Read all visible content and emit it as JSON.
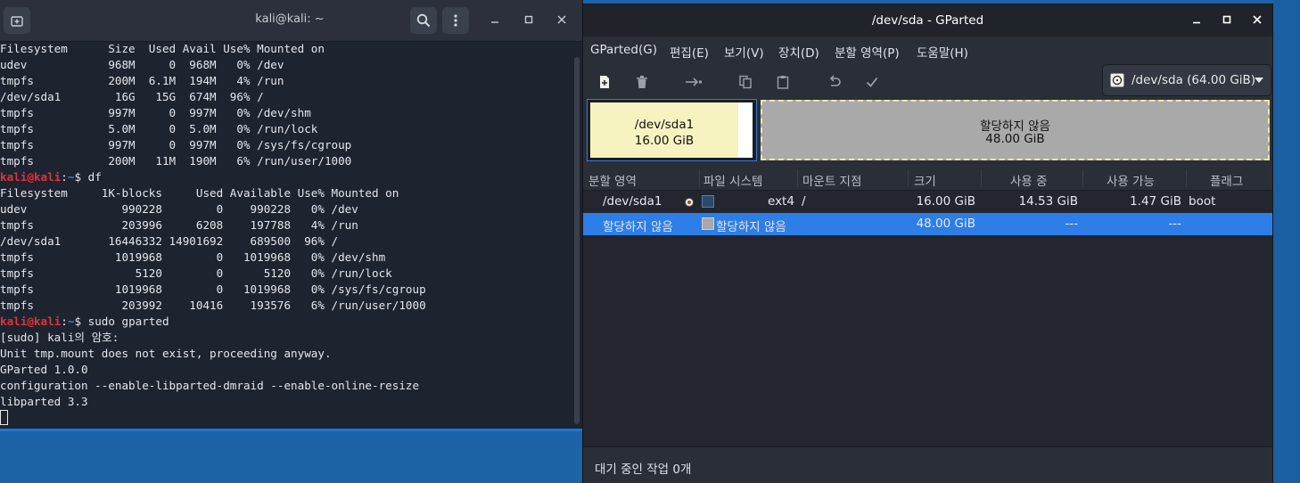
{
  "terminal": {
    "title": "kali@kali: ~",
    "prompt": {
      "user_host": "kali@kali",
      "sep": ":",
      "dir": "~",
      "sym": "$ "
    },
    "lines": [
      {
        "type": "out",
        "text": "Filesystem      Size  Used Avail Use% Mounted on"
      },
      {
        "type": "out",
        "text": "udev            968M     0  968M   0% /dev"
      },
      {
        "type": "out",
        "text": "tmpfs           200M  6.1M  194M   4% /run"
      },
      {
        "type": "out",
        "text": "/dev/sda1        16G   15G  674M  96% /"
      },
      {
        "type": "out",
        "text": "tmpfs           997M     0  997M   0% /dev/shm"
      },
      {
        "type": "out",
        "text": "tmpfs           5.0M     0  5.0M   0% /run/lock"
      },
      {
        "type": "out",
        "text": "tmpfs           997M     0  997M   0% /sys/fs/cgroup"
      },
      {
        "type": "out",
        "text": "tmpfs           200M   11M  190M   6% /run/user/1000"
      },
      {
        "type": "cmd",
        "text": "df"
      },
      {
        "type": "out",
        "text": "Filesystem     1K-blocks     Used Available Use% Mounted on"
      },
      {
        "type": "out",
        "text": "udev              990228        0    990228   0% /dev"
      },
      {
        "type": "out",
        "text": "tmpfs             203996     6208    197788   4% /run"
      },
      {
        "type": "out",
        "text": "/dev/sda1       16446332 14901692    689500  96% /"
      },
      {
        "type": "out",
        "text": "tmpfs            1019968        0   1019968   0% /dev/shm"
      },
      {
        "type": "out",
        "text": "tmpfs               5120        0      5120   0% /run/lock"
      },
      {
        "type": "out",
        "text": "tmpfs            1019968        0   1019968   0% /sys/fs/cgroup"
      },
      {
        "type": "out",
        "text": "tmpfs             203992    10416    193576   6% /run/user/1000"
      },
      {
        "type": "cmd",
        "text": "sudo gparted"
      },
      {
        "type": "out",
        "text": "[sudo] kali의 암호:"
      },
      {
        "type": "out",
        "text": "Unit tmp.mount does not exist, proceeding anyway."
      },
      {
        "type": "out",
        "text": "GParted 1.0.0"
      },
      {
        "type": "out",
        "text": "configuration --enable-libparted-dmraid --enable-online-resize"
      },
      {
        "type": "out",
        "text": "libparted 3.3"
      }
    ]
  },
  "gparted": {
    "title": "/dev/sda - GParted",
    "menu": [
      "GParted(G)",
      "편집(E)",
      "보기(V)",
      "장치(D)",
      "분할 영역(P)",
      "도움말(H)"
    ],
    "toolbar_icons": [
      "new-icon",
      "delete-icon",
      "resize-move-icon",
      "copy-icon",
      "paste-icon",
      "undo-icon",
      "apply-icon"
    ],
    "device_select": "/dev/sda (64.00 GiB)",
    "diskmap": {
      "sda1": {
        "name": "/dev/sda1",
        "size": "16.00 GiB",
        "used_fraction": 0.91,
        "color": "#f7f3c0"
      },
      "unallocated": {
        "name": "할당하지 않음",
        "size": "48.00 GiB",
        "color": "#a9a9a9"
      }
    },
    "columns": [
      "분할 영역",
      "파일 시스템",
      "마운트 지점",
      "크기",
      "사용 중",
      "사용 가능",
      "플래그"
    ],
    "rows": [
      {
        "partition": "/dev/sda1",
        "fs": "ext4",
        "fs_color": "#2e4a6b",
        "mount": "/",
        "size": "16.00 GiB",
        "used": "14.53 GiB",
        "unused": "1.47 GiB",
        "flags": "boot",
        "selected": false
      },
      {
        "partition": "할당하지 않음",
        "fs": "할당하지 않음",
        "fs_color": "#a9a9a9",
        "mount": "",
        "size": "48.00 GiB",
        "used": "---",
        "unused": "---",
        "flags": "",
        "selected": true
      }
    ],
    "status": "대기 중인 작업 0개"
  },
  "colors": {
    "terminal_bg": "#1e2330",
    "prompt_user": "#e0333b",
    "prompt_dir": "#3f7fe0",
    "selection": "#2d7ee6",
    "desktop": "#1d63a8"
  }
}
